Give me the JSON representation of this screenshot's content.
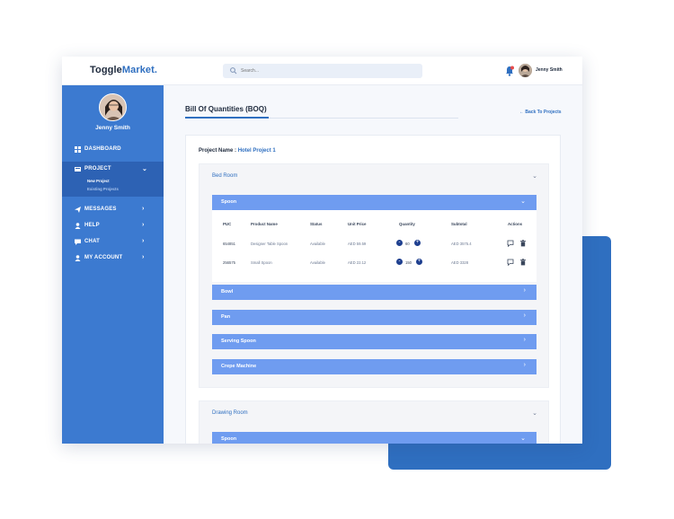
{
  "app": {
    "logo_main": "Toggle",
    "logo_accent": "Market",
    "search_placeholder": "Search...",
    "user_name": "Jenny Smith"
  },
  "sidebar": {
    "profile_name": "Jenny Smith",
    "items": [
      {
        "label": "DASHBOARD",
        "icon": "dashboard-icon"
      },
      {
        "label": "PROJECT",
        "icon": "project-icon",
        "chevron": "⌄",
        "subitems": [
          "New Project",
          "Existing Projects"
        ]
      },
      {
        "label": "MESSAGES",
        "icon": "send-icon",
        "chevron": "›"
      },
      {
        "label": "HELP",
        "icon": "user-icon",
        "chevron": "›"
      },
      {
        "label": "CHAT",
        "icon": "chat-icon",
        "chevron": "›"
      },
      {
        "label": "MY ACCOUNT",
        "icon": "user-icon",
        "chevron": "›"
      }
    ]
  },
  "page": {
    "title": "Bill Of Quantities (BOQ)",
    "back_link": "← Back To Projects",
    "project_label": "Project Name :",
    "project_name": "Hotel Project 1"
  },
  "rooms": [
    {
      "name": "Bed Room",
      "categories": [
        {
          "name": "Spoon",
          "expanded": true,
          "chevron": "⌄"
        },
        {
          "name": "Bowl",
          "chevron": "›"
        },
        {
          "name": "Pan",
          "chevron": "›"
        },
        {
          "name": "Serving Spoon",
          "chevron": "›"
        },
        {
          "name": "Crepe Machine",
          "chevron": "›"
        }
      ]
    },
    {
      "name": "Drawing Room",
      "categories": [
        {
          "name": "Spoon",
          "chevron": "⌄"
        }
      ]
    }
  ],
  "table": {
    "headers": [
      "PUC",
      "Product Name",
      "Status",
      "Unit Price",
      "Quantity",
      "Subtotal",
      "Actions"
    ],
    "rows": [
      {
        "puc": "654851",
        "product": "Designer Table Spoon",
        "status": "Available",
        "unit_price": "AED 59.59",
        "quantity": "60",
        "subtotal": "AED 3575.4"
      },
      {
        "puc": "256575",
        "product": "Small Spoon",
        "status": "Available",
        "unit_price": "AED 22.12",
        "quantity": "150",
        "subtotal": "AED 3328"
      }
    ]
  },
  "colors": {
    "sidebar": "#3c7ad0",
    "sidebar_active": "#2d62b4",
    "accent": "#2f6fc0",
    "category_band": "#6f9cf0",
    "quantity_button": "#1e3f8f"
  }
}
